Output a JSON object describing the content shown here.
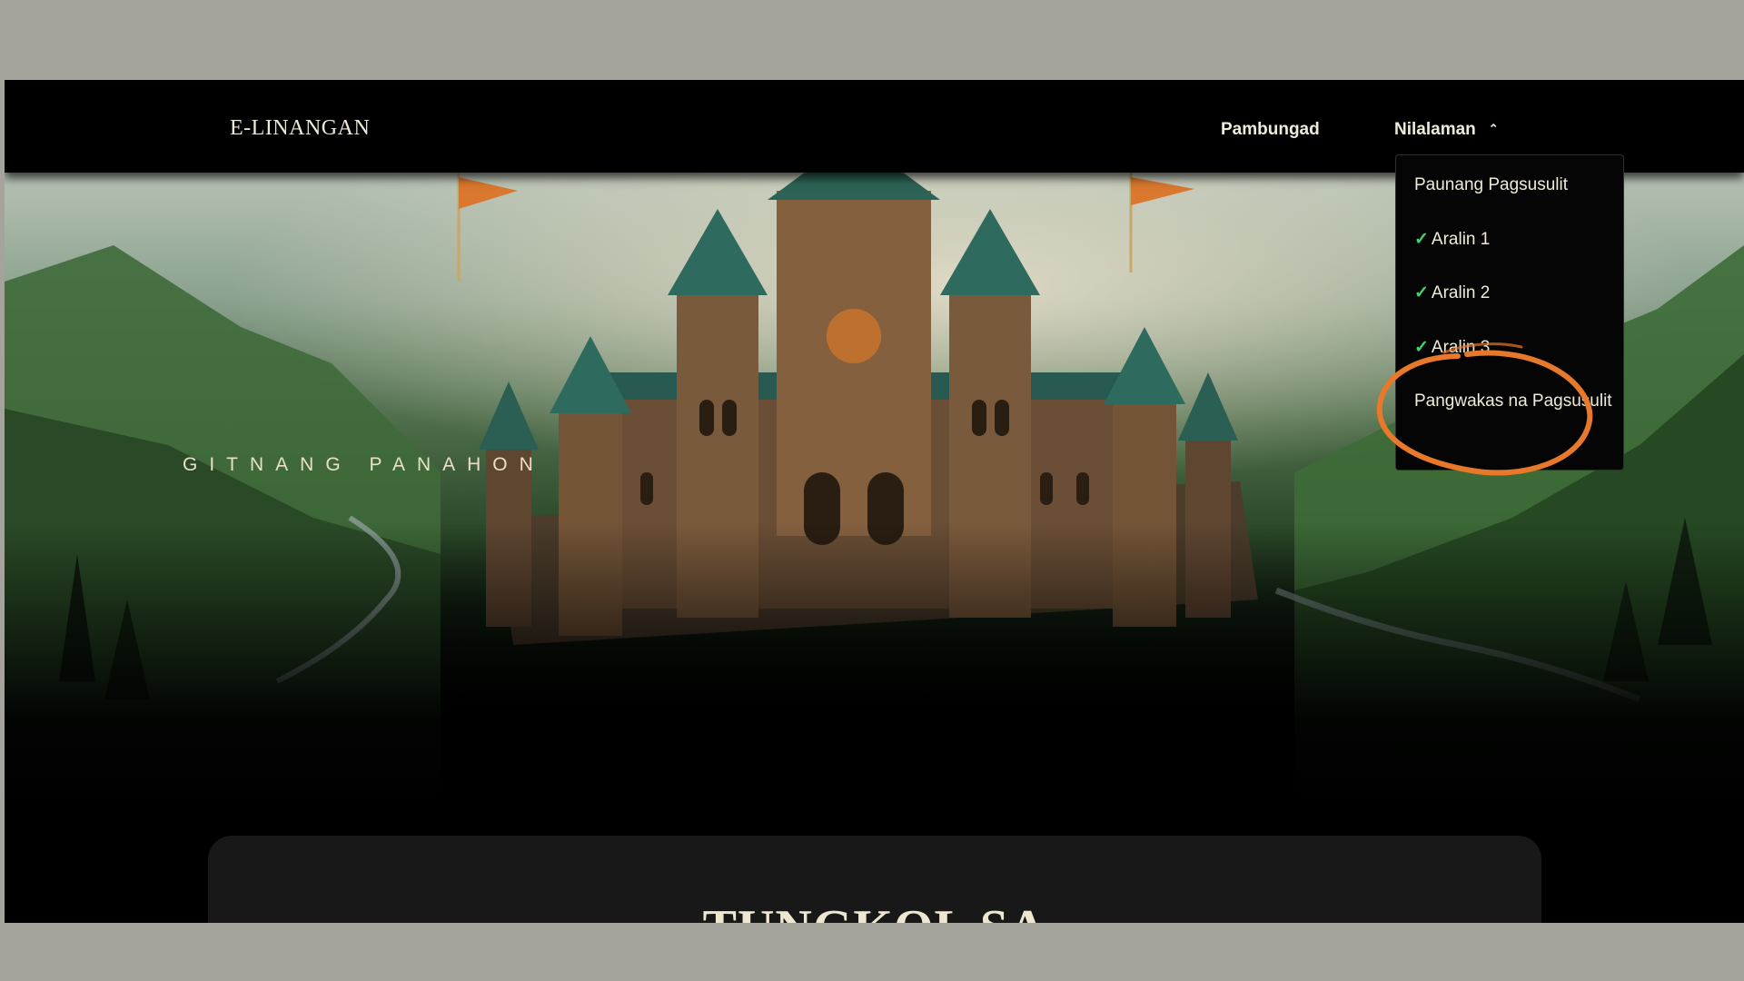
{
  "navbar": {
    "brand": "E-LINANGAN",
    "home_label": "Pambungad",
    "menu_label": "Nilalaman",
    "menu_icon": "chevron-up-icon"
  },
  "hero": {
    "tagline": "GITNANG PANAHON"
  },
  "dropdown": {
    "items": [
      {
        "label": "Paunang Pagsusulit",
        "checked": false
      },
      {
        "label": "Aralin 1",
        "checked": true
      },
      {
        "label": "Aralin 2",
        "checked": true
      },
      {
        "label": "Aralin 3",
        "checked": true
      },
      {
        "label": "Pangwakas na Pagsusulit",
        "checked": false
      }
    ],
    "check_icon": "check-icon"
  },
  "content": {
    "title": "TUNGKOL SA"
  },
  "colors": {
    "background_outer": "#a4a49c",
    "page_background": "#000000",
    "text_cream": "#f0ebd8",
    "check_green": "#3fd66a",
    "annotation_orange": "#e8792a",
    "card_background": "#181818"
  }
}
